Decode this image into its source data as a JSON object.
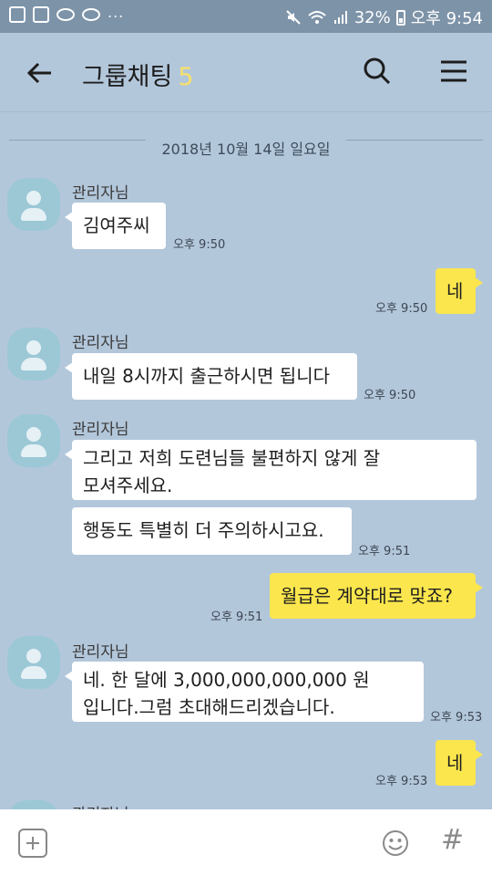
{
  "status_bar": {
    "battery_percent": "32%",
    "time": "오후 9:54",
    "left_indicator": "..."
  },
  "header": {
    "title": "그룹채팅",
    "member_count": "5"
  },
  "chat": {
    "date_divider": "2018년 10월 14일 일요일",
    "messages": [
      {
        "sender": "관리자님",
        "text": "김여주씨",
        "time": "오후 9:50"
      },
      {
        "text": "네",
        "time": "오후 9:50"
      },
      {
        "sender": "관리자님",
        "text": "내일 8시까지 출근하시면 됩니다",
        "time": "오후 9:50"
      },
      {
        "sender": "관리자님",
        "text": "그리고 저희 도련님들 불편하지 않게 잘\n모셔주세요."
      },
      {
        "text": "행동도 특별히 더 주의하시고요.",
        "time": "오후 9:51"
      },
      {
        "text": "월급은 계약대로 맞죠?",
        "time": "오후 9:51"
      },
      {
        "sender": "관리자님",
        "text": "네. 한 달에 3,000,000,000,000 원\n입니다.그럼 초대해드리겠습니다.",
        "time": "오후 9:53"
      },
      {
        "text": "네",
        "time": "오후 9:53"
      },
      {
        "sender": "관리자님"
      }
    ]
  },
  "colors": {
    "background": "#b3c7db",
    "my_bubble": "#fbe64d",
    "other_bubble": "#ffffff",
    "member_count": "#f6e06b"
  }
}
